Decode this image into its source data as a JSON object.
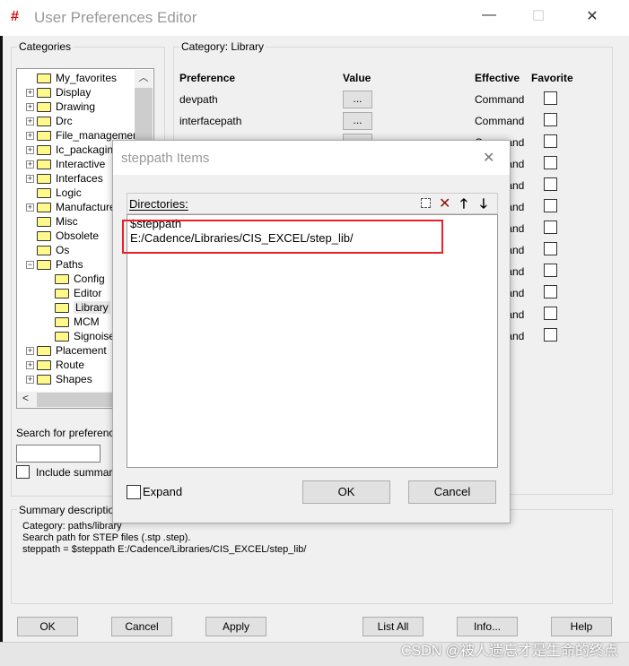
{
  "window": {
    "title": "User Preferences Editor",
    "min": "—",
    "max": "☐",
    "close": "✕"
  },
  "categories": {
    "label": "Categories",
    "items": [
      {
        "label": "My_favorites",
        "expander": ""
      },
      {
        "label": "Display",
        "expander": "+"
      },
      {
        "label": "Drawing",
        "expander": "+"
      },
      {
        "label": "Drc",
        "expander": "+"
      },
      {
        "label": "File_management",
        "expander": "+"
      },
      {
        "label": "Ic_packaging",
        "expander": "+"
      },
      {
        "label": "Interactive",
        "expander": "+"
      },
      {
        "label": "Interfaces",
        "expander": "+"
      },
      {
        "label": "Logic",
        "expander": ""
      },
      {
        "label": "Manufacture",
        "expander": "+"
      },
      {
        "label": "Misc",
        "expander": ""
      },
      {
        "label": "Obsolete",
        "expander": ""
      },
      {
        "label": "Os",
        "expander": ""
      },
      {
        "label": "Paths",
        "expander": "−"
      },
      {
        "label": "Config",
        "child": true
      },
      {
        "label": "Editor",
        "child": true
      },
      {
        "label": "Library",
        "child": true,
        "selected": true
      },
      {
        "label": "MCM",
        "child": true
      },
      {
        "label": "Signoise",
        "child": true
      },
      {
        "label": "Placement",
        "expander": "+"
      },
      {
        "label": "Route",
        "expander": "+"
      },
      {
        "label": "Shapes",
        "expander": "+"
      }
    ]
  },
  "search": {
    "label": "Search for preference:",
    "value": "",
    "include_label": "Include summary i"
  },
  "category": {
    "label": "Category:  Library",
    "headers": {
      "preference": "Preference",
      "value": "Value",
      "effective": "Effective",
      "favorite": "Favorite"
    },
    "rows": [
      {
        "name": "devpath",
        "value": "...",
        "effective": "Command"
      },
      {
        "name": "interfacepath",
        "value": "...",
        "effective": "Command"
      },
      {
        "name": "",
        "value": "...",
        "effective": "Command"
      },
      {
        "name": "",
        "value": "",
        "effective": "Command"
      },
      {
        "name": "",
        "value": "",
        "effective": "Command"
      },
      {
        "name": "",
        "value": "",
        "effective": "Command"
      },
      {
        "name": "",
        "value": "",
        "effective": "Command"
      },
      {
        "name": "",
        "value": "",
        "effective": "Command"
      },
      {
        "name": "",
        "value": "",
        "effective": "Command"
      },
      {
        "name": "",
        "value": "",
        "effective": "Command"
      },
      {
        "name": "",
        "value": "",
        "effective": "Command"
      },
      {
        "name": "",
        "value": "",
        "effective": "Command"
      }
    ]
  },
  "summary": {
    "label": "Summary description",
    "lines": [
      "Category: paths/library",
      "Search path for STEP files (.stp .step).",
      "steppath = $steppath E:/Cadence/Libraries/CIS_EXCEL/step_lib/"
    ]
  },
  "buttons": {
    "ok": "OK",
    "cancel": "Cancel",
    "apply": "Apply",
    "list_all": "List All",
    "info": "Info...",
    "help": "Help"
  },
  "dialog": {
    "title": "steppath Items",
    "close": "✕",
    "directories_label": "Directories:",
    "entries": [
      "$steppath",
      "E:/Cadence/Libraries/CIS_EXCEL/step_lib/"
    ],
    "expand_label": "Expand",
    "ok": "OK",
    "cancel": "Cancel",
    "highlight_color": "#e8202a"
  },
  "watermark": "CSDN @被人遗忘才是生命的终点"
}
